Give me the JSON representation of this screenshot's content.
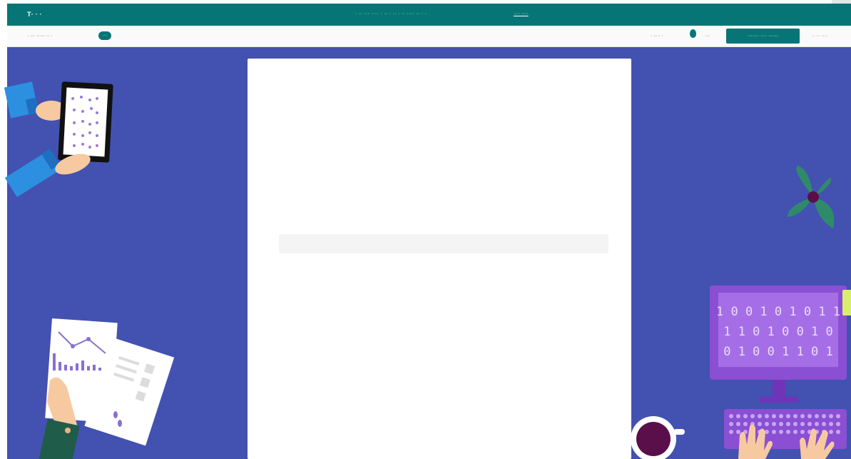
{
  "topbar": {
    "brand": "T· · ·",
    "announcement": "· ·· ··· ···· · ·· · ·· · ·· ···· ·· · ·",
    "announcement_link": "···· ····"
  },
  "navbar": {
    "breadcrumb": "· ··· ····· ·· ·",
    "pill": "···",
    "language": "· ···· ·",
    "theme": "···",
    "cta_label": "······· ···· ······",
    "account": "·· ·· ····"
  },
  "article": {
    "title": "",
    "intro": "",
    "field_label": "",
    "code_value": "",
    "paragraph_2": "",
    "paragraph_3": "",
    "step_1": "",
    "step_2": ""
  },
  "illustration": {
    "binary_line_1": "1 0 0 1 0 1 0 1 1",
    "binary_line_2": "1 1 0 1 0 0 1 0",
    "binary_line_3": "0 1 0 0 1 1 0 1",
    "palette": {
      "background": "#4351b0",
      "accent": "#077575",
      "monitor": "#8a4fd3",
      "screen": "#a66ee6",
      "leaf": "#2f8a6a",
      "sleeve": "#2d8fe0",
      "skin": "#f7c9a0",
      "cup": "#5a0f4a",
      "highlight": "#d9ef6c"
    }
  },
  "colors": {
    "brand": "#077575",
    "background": "#4351b0",
    "card": "#ffffff"
  }
}
